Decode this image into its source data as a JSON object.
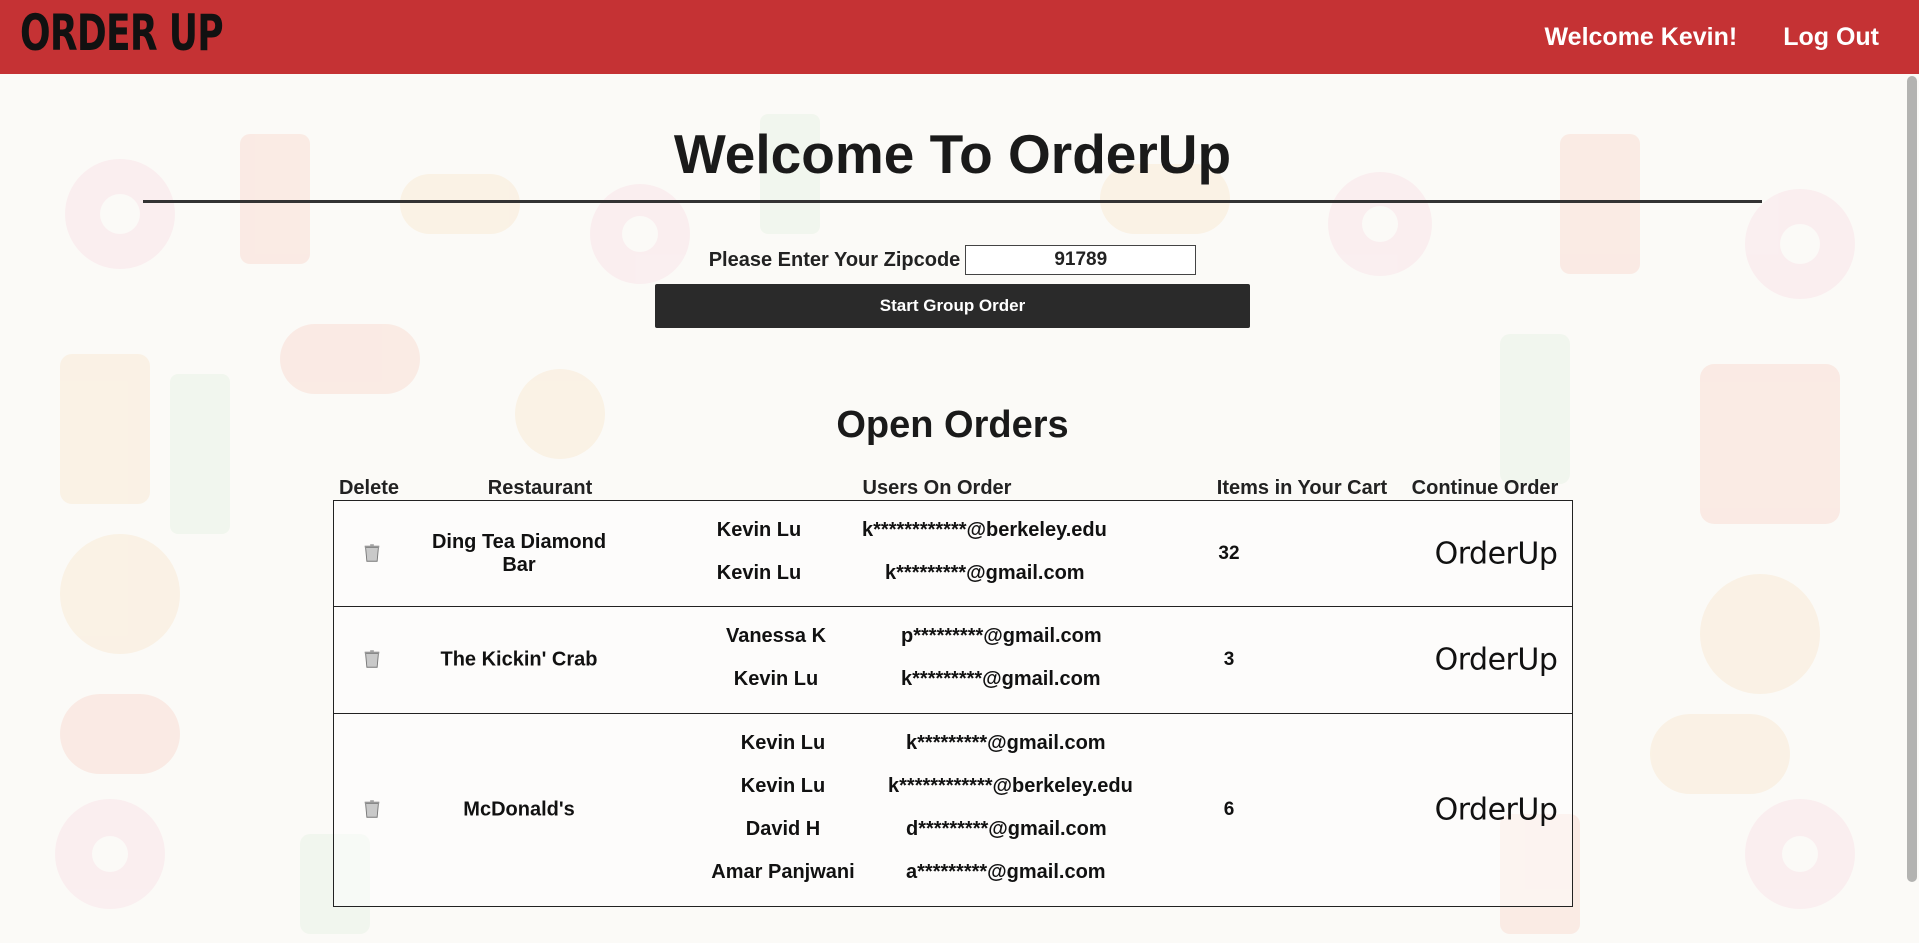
{
  "nav": {
    "logo": "ORDER UP",
    "welcome": "Welcome Kevin!",
    "logout": "Log Out"
  },
  "main": {
    "title": "Welcome To OrderUp",
    "zip_label": "Please Enter Your Zipcode",
    "zip_value": "91789",
    "start_button": "Start Group Order",
    "orders_title": "Open Orders",
    "headers": {
      "delete": "Delete",
      "restaurant": "Restaurant",
      "users": "Users On Order",
      "items": "Items in Your Cart",
      "continue": "Continue Order"
    },
    "orders": [
      {
        "restaurant": "Ding Tea Diamond Bar",
        "items": "32",
        "continue_label": "OrderUp",
        "users": [
          {
            "name": "Kevin Lu",
            "email": "k************@berkeley.edu"
          },
          {
            "name": "Kevin Lu",
            "email": "k*********@gmail.com"
          }
        ]
      },
      {
        "restaurant": "The Kickin' Crab",
        "items": "3",
        "continue_label": "OrderUp",
        "users": [
          {
            "name": "Vanessa K",
            "email": "p*********@gmail.com"
          },
          {
            "name": "Kevin Lu",
            "email": "k*********@gmail.com"
          }
        ]
      },
      {
        "restaurant": "McDonald's",
        "items": "6",
        "continue_label": "OrderUp",
        "users": [
          {
            "name": "Kevin Lu",
            "email": "k*********@gmail.com"
          },
          {
            "name": "Kevin Lu",
            "email": "k************@berkeley.edu"
          },
          {
            "name": "David H",
            "email": "d*********@gmail.com"
          },
          {
            "name": "Amar Panjwani",
            "email": "a*********@gmail.com"
          }
        ]
      }
    ]
  },
  "colors": {
    "navbar": "#c53234",
    "button": "#2a2a2a"
  },
  "icons": {
    "delete": "trash-icon"
  }
}
